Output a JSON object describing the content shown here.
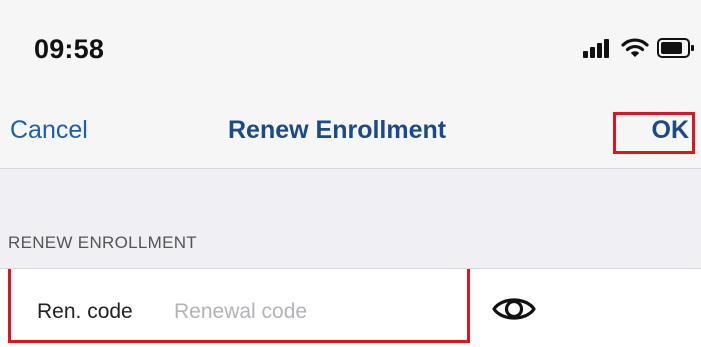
{
  "status_bar": {
    "time": "09:58",
    "icons": [
      "cellular-signal-icon",
      "wifi-icon",
      "battery-icon"
    ]
  },
  "nav": {
    "cancel_label": "Cancel",
    "title": "Renew Enrollment",
    "ok_label": "OK"
  },
  "form": {
    "section_header": "RENEW ENROLLMENT",
    "field_label": "Ren. code",
    "field_value": "",
    "field_placeholder": "Renewal code",
    "toggle_icon": "eye-icon"
  },
  "colors": {
    "accent": "#1c5faa",
    "title": "#1c4a87",
    "highlight": "#e0141e",
    "group_background": "#efeff4",
    "bar_background": "#f6f6f6"
  }
}
